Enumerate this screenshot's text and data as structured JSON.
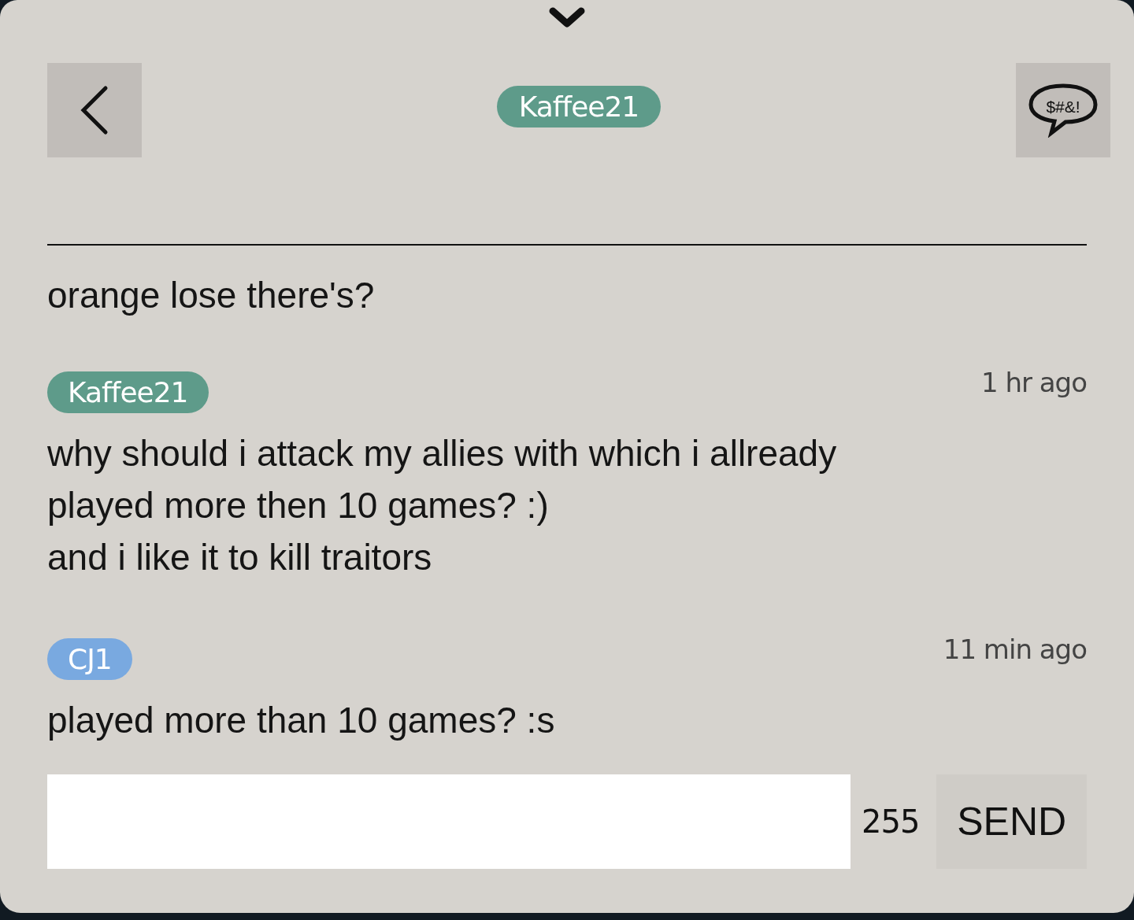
{
  "header": {
    "partner": {
      "name": "Kaffee21",
      "color": "#5e9b8a"
    },
    "filter_button": {
      "label": "$#&!"
    }
  },
  "messages": [
    {
      "kind": "continuation",
      "text": "orange lose there's?"
    },
    {
      "kind": "message",
      "author": {
        "name": "Kaffee21",
        "color": "#5e9b8a"
      },
      "time": "1 hr ago",
      "text": "why should i attack my allies with which i allready\nplayed more then 10 games? :)\nand i like it to kill traitors"
    },
    {
      "kind": "message",
      "author": {
        "name": "CJ1",
        "color": "#79a9e0"
      },
      "time": "11 min ago",
      "text": "played more than 10 games? :s"
    }
  ],
  "composer": {
    "remaining": "255",
    "send_label": "SEND"
  }
}
